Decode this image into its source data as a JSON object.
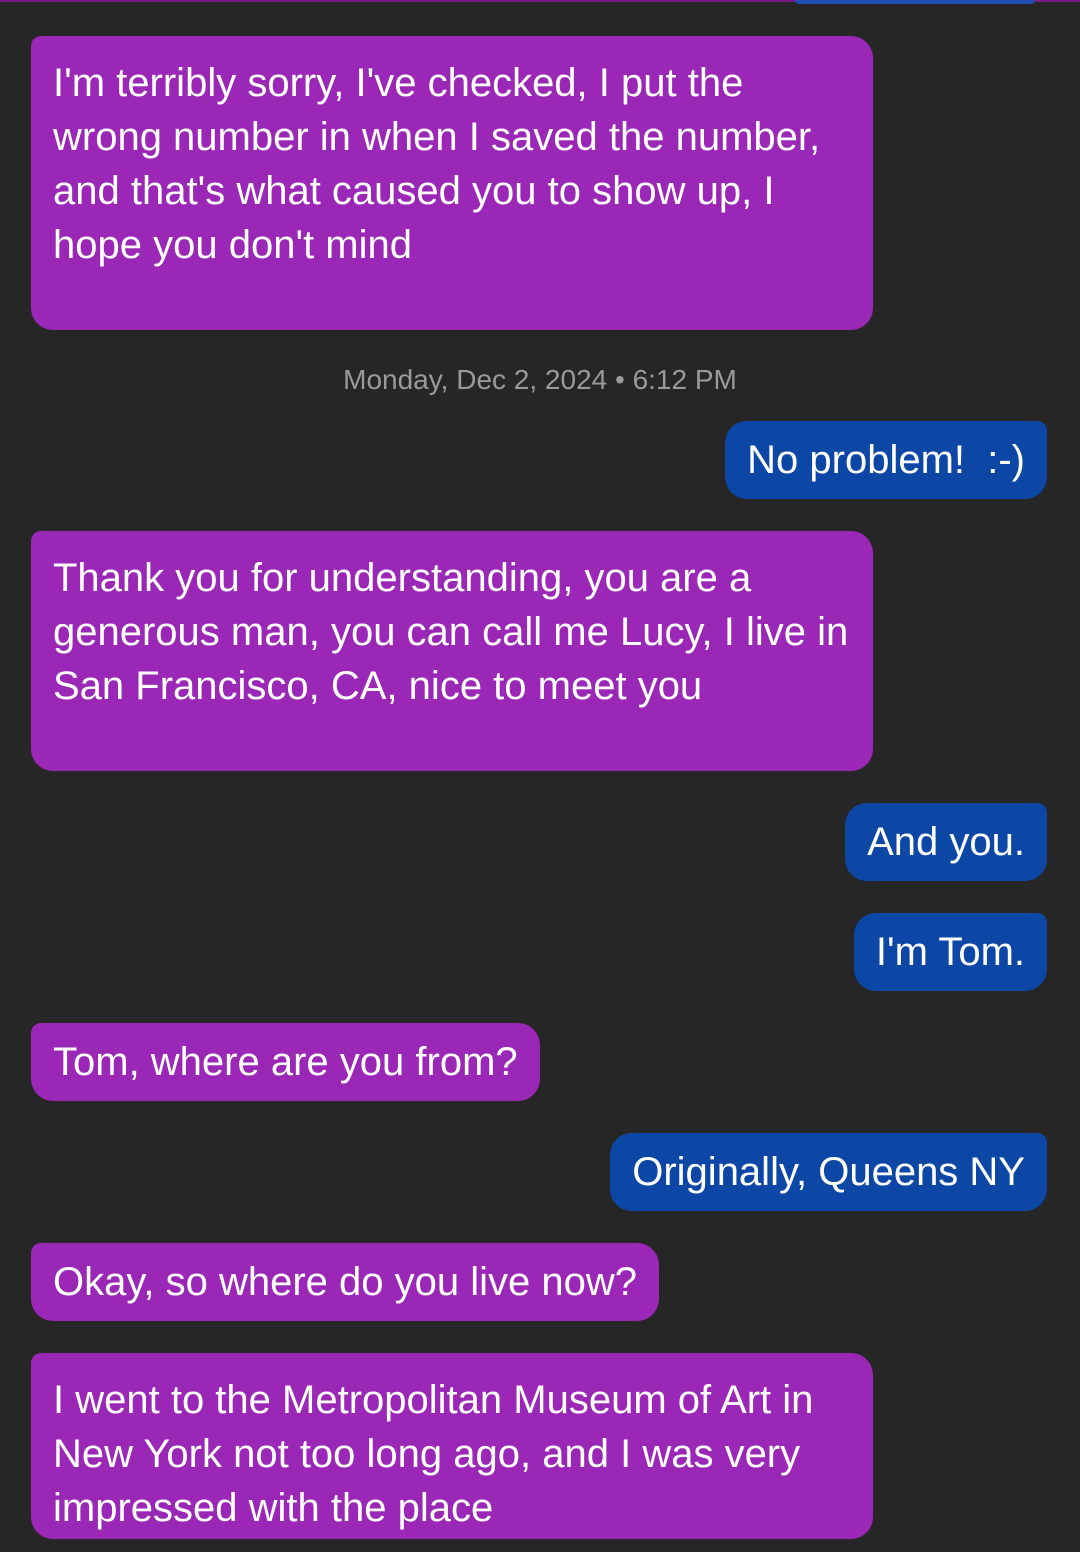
{
  "conversation": {
    "messages": [
      {
        "direction": "incoming",
        "text": "I'm terribly sorry, I've checked, I put the wrong number in when I saved the number, and that's what caused you to show up, I hope you don't mind"
      },
      {
        "direction": "outgoing",
        "text": "No problem!  :-)"
      },
      {
        "direction": "incoming",
        "text": "Thank you for understanding, you are a generous man, you can call me Lucy, I live in San Francisco, CA, nice to meet you"
      },
      {
        "direction": "outgoing",
        "text": "And you."
      },
      {
        "direction": "outgoing",
        "text": "I'm Tom."
      },
      {
        "direction": "incoming",
        "text": "Tom, where are you from?"
      },
      {
        "direction": "outgoing",
        "text": "Originally, Queens NY"
      },
      {
        "direction": "incoming",
        "text": "Okay, so where do you live now?"
      },
      {
        "direction": "incoming",
        "text": "I went to the Metropolitan Museum of Art in New York not too long ago, and I was very impressed with the place"
      }
    ],
    "timestamp": "Monday, Dec 2, 2024 • 6:12 PM"
  },
  "colors": {
    "background": "#262626",
    "incoming_bubble": "#9a27b5",
    "outgoing_bubble": "#0d47a6",
    "timestamp_text": "#9a9a9a"
  }
}
